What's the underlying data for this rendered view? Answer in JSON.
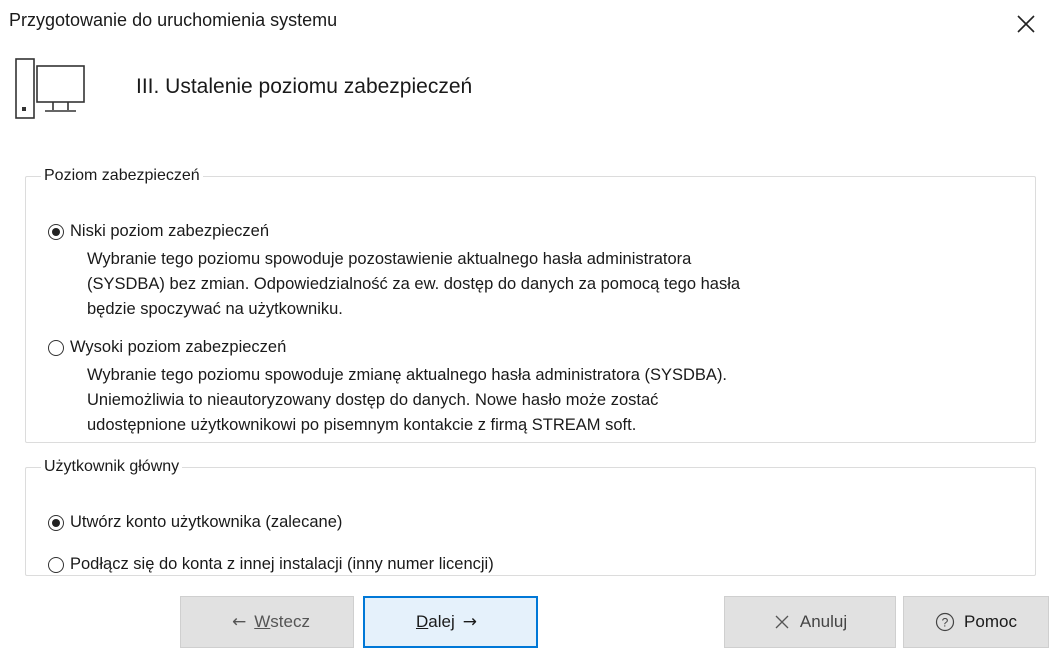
{
  "window": {
    "title": "Przygotowanie do uruchomienia systemu"
  },
  "header": {
    "step_title": "III. Ustalenie poziomu zabezpieczeń"
  },
  "security": {
    "legend": "Poziom zabezpieczeń",
    "low": {
      "label": "Niski poziom zabezpieczeń",
      "checked": true,
      "desc": [
        "Wybranie tego poziomu spowoduje pozostawienie aktualnego hasła administratora",
        "(SYSDBA) bez zmian. Odpowiedzialność za ew. dostęp do danych za pomocą tego hasła",
        "będzie spoczywać na użytkowniku."
      ]
    },
    "high": {
      "label": "Wysoki poziom zabezpieczeń",
      "checked": false,
      "desc": [
        "Wybranie tego poziomu spowoduje zmianę aktualnego hasła administratora (SYSDBA).",
        "Uniemożliwia to nieautoryzowany dostęp do danych. Nowe hasło może zostać",
        "udostępnione użytkownikowi po pisemnym kontakcie z firmą STREAM soft."
      ]
    }
  },
  "main_user": {
    "legend": "Użytkownik główny",
    "create": {
      "label": "Utwórz konto użytkownika (zalecane)",
      "checked": true
    },
    "connect": {
      "label": "Podłącz się do konta z innej instalacji (inny numer licencji)",
      "checked": false
    }
  },
  "buttons": {
    "back": {
      "arrow": "←",
      "mnemonic": "W",
      "rest": "stecz"
    },
    "next": {
      "mnemonic": "D",
      "rest": "alej",
      "arrow": "→"
    },
    "cancel": {
      "label": "Anuluj"
    },
    "help": {
      "label": "Pomoc"
    }
  },
  "colors": {
    "accent": "#0078d7",
    "button_bg": "#e1e1e1",
    "primary_bg": "#e5f1fb"
  },
  "icons": [
    "close-icon",
    "computer-icon",
    "cancel-x-icon",
    "help-circle-icon"
  ]
}
